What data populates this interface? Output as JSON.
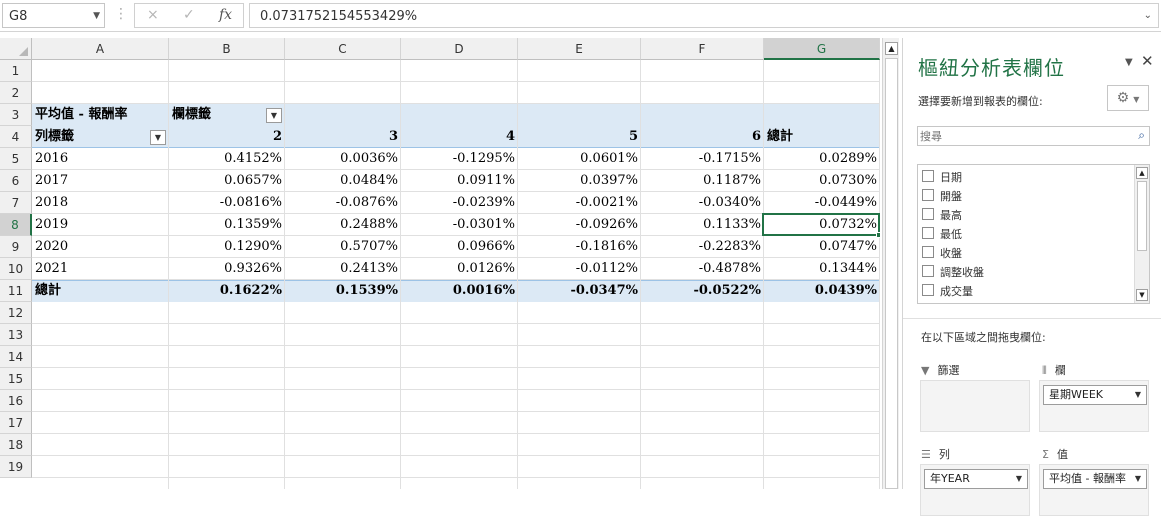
{
  "formula_bar": {
    "name_box": "G8",
    "cancel_icon": "×",
    "enter_icon": "✓",
    "fx_label": "fx",
    "value": "0.0731752154553429%"
  },
  "grid": {
    "columns": [
      "A",
      "B",
      "C",
      "D",
      "E",
      "F",
      "G"
    ],
    "selected_column": "G",
    "rows": [
      "1",
      "2",
      "3",
      "4",
      "5",
      "6",
      "7",
      "8",
      "9",
      "10",
      "11",
      "12",
      "13",
      "14",
      "15",
      "16",
      "17",
      "18",
      "19"
    ],
    "selected_row": "8",
    "pivot": {
      "value_label": "平均值 - 報酬率",
      "col_label_header": "欄標籤",
      "row_label_header": "列標籤",
      "col_headers": [
        "2",
        "3",
        "4",
        "5",
        "6",
        "總計"
      ],
      "rows": [
        {
          "label": "2016",
          "values": [
            "0.4152%",
            "0.0036%",
            "-0.1295%",
            "0.0601%",
            "-0.1715%",
            "0.0289%"
          ]
        },
        {
          "label": "2017",
          "values": [
            "0.0657%",
            "0.0484%",
            "0.0911%",
            "0.0397%",
            "0.1187%",
            "0.0730%"
          ]
        },
        {
          "label": "2018",
          "values": [
            "-0.0816%",
            "-0.0876%",
            "-0.0239%",
            "-0.0021%",
            "-0.0340%",
            "-0.0449%"
          ]
        },
        {
          "label": "2019",
          "values": [
            "0.1359%",
            "0.2488%",
            "-0.0301%",
            "-0.0926%",
            "0.1133%",
            "0.0732%"
          ]
        },
        {
          "label": "2020",
          "values": [
            "0.1290%",
            "0.5707%",
            "0.0966%",
            "-0.1816%",
            "-0.2283%",
            "0.0747%"
          ]
        },
        {
          "label": "2021",
          "values": [
            "0.9326%",
            "0.2413%",
            "0.0126%",
            "-0.0112%",
            "-0.4878%",
            "0.1344%"
          ]
        }
      ],
      "total": {
        "label": "總計",
        "values": [
          "0.1622%",
          "0.1539%",
          "0.0016%",
          "-0.0347%",
          "-0.0522%",
          "0.0439%"
        ]
      }
    }
  },
  "pivot_pane": {
    "title": "樞紐分析表欄位",
    "subtitle": "選擇要新增到報表的欄位:",
    "search_placeholder": "搜尋",
    "fields": [
      {
        "label": "日期",
        "checked": false
      },
      {
        "label": "開盤",
        "checked": false
      },
      {
        "label": "最高",
        "checked": false
      },
      {
        "label": "最低",
        "checked": false
      },
      {
        "label": "收盤",
        "checked": false
      },
      {
        "label": "調整收盤",
        "checked": false
      },
      {
        "label": "成交量",
        "checked": false
      },
      {
        "label": "年YEAR",
        "checked": true
      }
    ],
    "drag_label": "在以下區域之間拖曳欄位:",
    "areas": {
      "filters": {
        "label": "篩選",
        "icon": "filter-icon"
      },
      "columns": {
        "label": "欄",
        "icon": "columns-icon",
        "chip": "星期WEEK"
      },
      "rows": {
        "label": "列",
        "icon": "rows-icon",
        "chip": "年YEAR"
      },
      "values": {
        "label": "值",
        "icon": "sigma-icon",
        "chip": "平均值 - 報酬率"
      }
    }
  },
  "colors": {
    "accent": "#217346",
    "pivot_band": "#dce9f5"
  }
}
